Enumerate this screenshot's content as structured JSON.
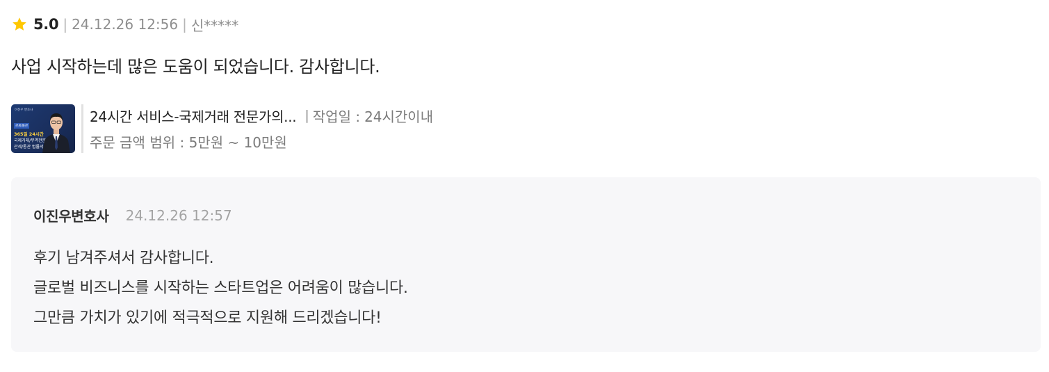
{
  "review": {
    "rating": "5.0",
    "separator": "|",
    "date": "24.12.26 12:56",
    "author": "신*****",
    "text": "사업 시작하는데 많은 도움이 되었습니다. 감사합니다."
  },
  "service": {
    "thumbnail": {
      "top_text": "이진우 변호사",
      "badge": "관세/통관",
      "headline": "365일 24시간",
      "line1": "국제거래/무역전문가의",
      "line2": "관세/통관 법률서비스"
    },
    "title": "24시간 서비스-국제거래 전문가의...",
    "work_separator": "|",
    "work_label": "작업일 :",
    "work_value": "24시간이내",
    "price_range": "주문 금액 범위 : 5만원 ~ 10만원"
  },
  "reply": {
    "author": "이진우변호사",
    "date": "24.12.26 12:57",
    "lines": [
      "후기 남겨주셔서 감사합니다.",
      "글로벌 비즈니스를 시작하는 스타트업은 어려움이 많습니다.",
      "그만큼 가치가 있기에 적극적으로 지원해 드리겠습니다!"
    ]
  },
  "colors": {
    "star": "#FFC700",
    "reply_background": "#F7F7F9",
    "thumbnail_background": "#1D3A72"
  },
  "icons": {
    "star": "star-icon"
  }
}
